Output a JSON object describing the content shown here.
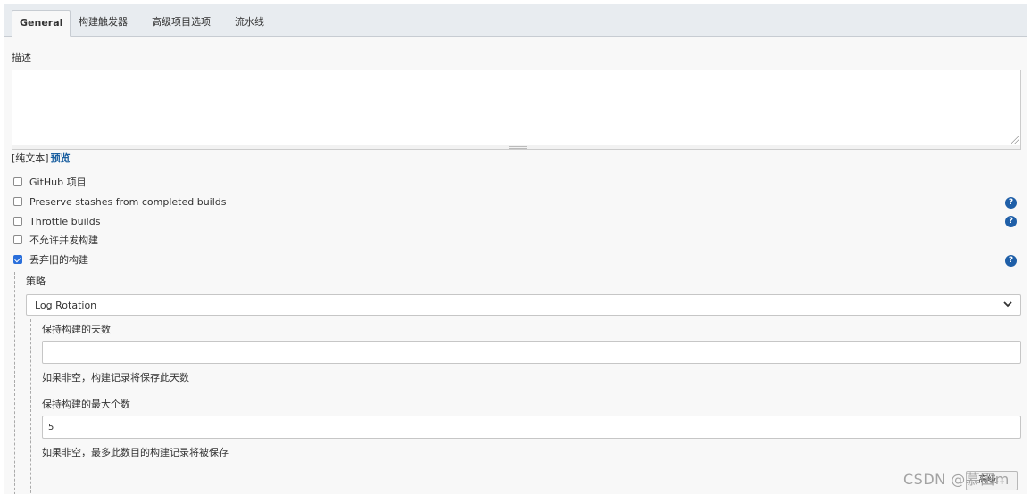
{
  "tabs": [
    {
      "label": "General",
      "active": true
    },
    {
      "label": "构建触发器",
      "active": false
    },
    {
      "label": "高级项目选项",
      "active": false
    },
    {
      "label": "流水线",
      "active": false
    }
  ],
  "description": {
    "label": "描述",
    "value": "",
    "format_plain": "[纯文本]",
    "format_preview": "预览"
  },
  "options": [
    {
      "label": "GitHub 项目",
      "checked": false,
      "help": false
    },
    {
      "label": "Preserve stashes from completed builds",
      "checked": false,
      "help": true
    },
    {
      "label": "Throttle builds",
      "checked": false,
      "help": true
    },
    {
      "label": "不允许并发构建",
      "checked": false,
      "help": false
    },
    {
      "label": "丢弃旧的构建",
      "checked": true,
      "help": true
    }
  ],
  "strategy": {
    "label": "策略",
    "selected": "Log Rotation",
    "days_label": "保持构建的天数",
    "days_value": "",
    "days_hint": "如果非空，构建记录将保存此天数",
    "max_label": "保持构建的最大个数",
    "max_value": "5",
    "max_hint": "如果非空，最多此数目的构建记录将被保存",
    "advanced_button": "高级..."
  },
  "icons": {
    "help": "help-circle-icon",
    "chevron": "chevron-down-icon"
  },
  "colors": {
    "accent": "#1f5fa8",
    "checkbox": "#2a6fdb",
    "link": "#1a5fa0"
  },
  "watermark": "CSDN @慕田m"
}
